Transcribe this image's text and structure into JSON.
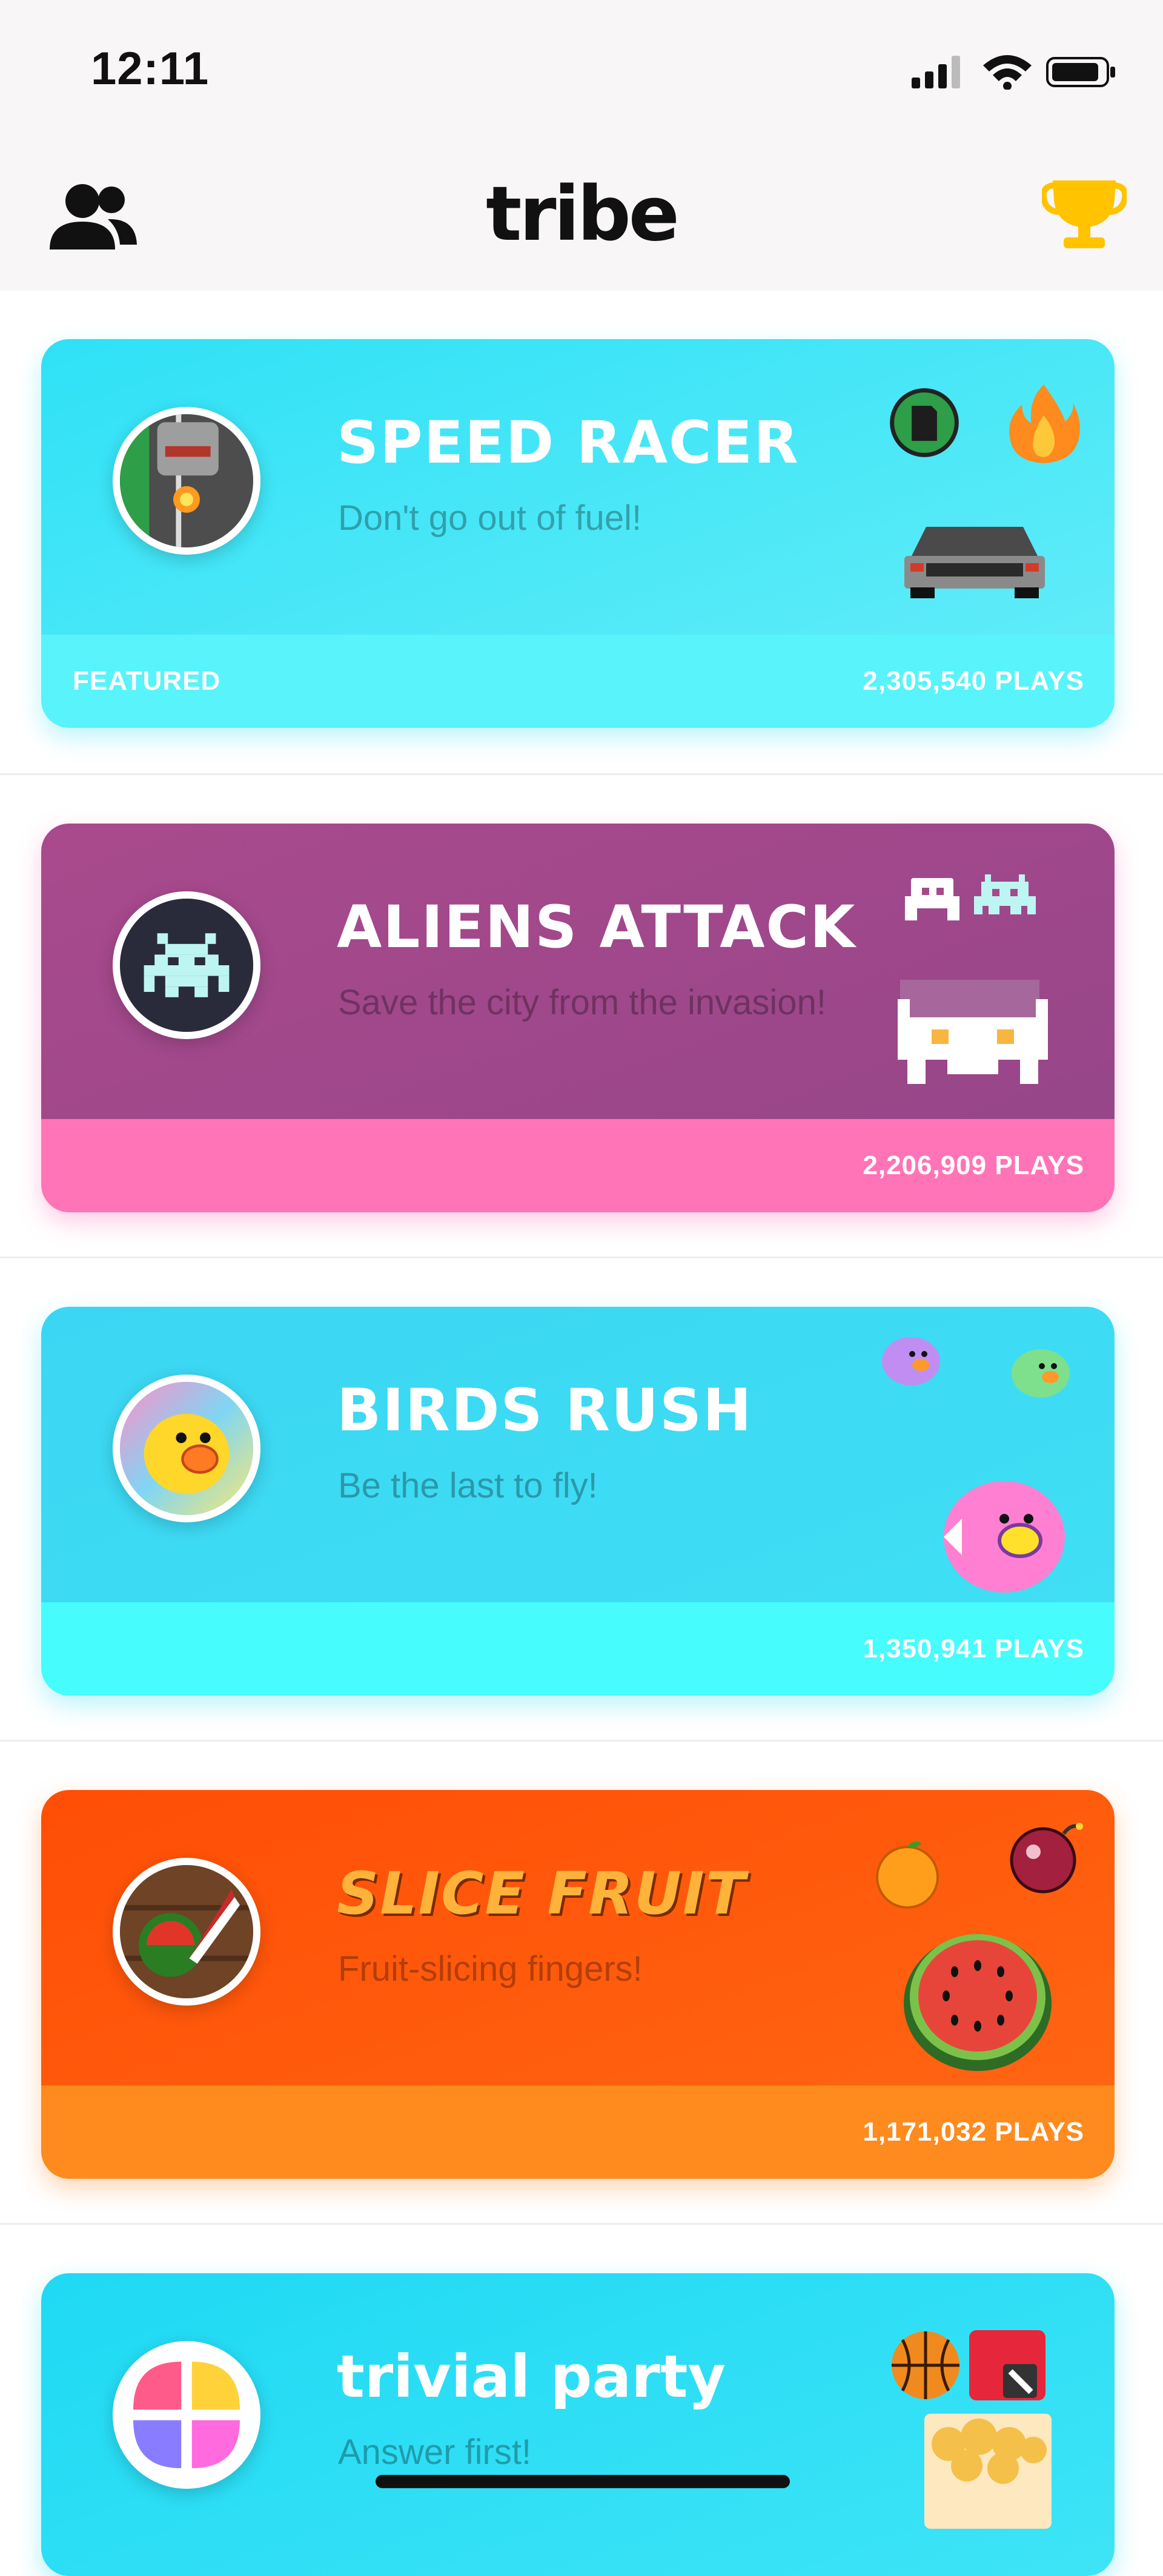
{
  "status_bar": {
    "time": "12:11"
  },
  "nav": {
    "title": "tribe"
  },
  "games": [
    {
      "title": "SPEED RACER",
      "subtitle": "Don't go out of fuel!",
      "tag": "FEATURED",
      "plays": "2,305,540 PLAYS"
    },
    {
      "title": "ALIENS ATTACK",
      "subtitle": "Save the city from the invasion!",
      "plays": "2,206,909 PLAYS"
    },
    {
      "title": "BIRDS RUSH",
      "subtitle": "Be the last to fly!",
      "plays": "1,350,941 PLAYS"
    },
    {
      "title": "SLICE FRUIT",
      "subtitle": "Fruit-slicing fingers!",
      "plays": "1,171,032 PLAYS"
    },
    {
      "title": "trivial party",
      "subtitle": "Answer first!"
    }
  ],
  "icons": {
    "friends": "friends-icon",
    "trophy": "trophy-icon",
    "signal": "signal-icon",
    "wifi": "wifi-icon",
    "battery": "battery-icon"
  },
  "colors": {
    "speed_racer": "#3fe0f6",
    "aliens_attack": "#a64a8a",
    "birds_rush": "#3ddcf3",
    "slice_fruit": "#ff5a0e",
    "trivial_party": "#1fd9f4",
    "trophy": "#ffc300"
  }
}
